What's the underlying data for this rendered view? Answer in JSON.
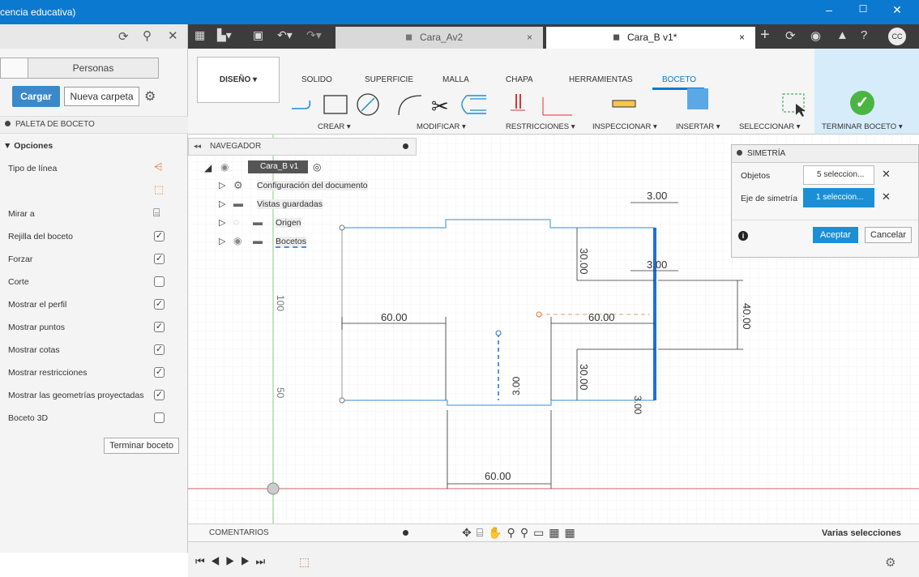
{
  "window": {
    "title": "cencia educativa)",
    "controls": [
      "–",
      "☐",
      "✕"
    ]
  },
  "left_panel": {
    "tab_right": "Personas",
    "load_button": "Cargar",
    "new_folder_button": "Nueva carpeta",
    "palette_header": "PALETA DE BOCETO",
    "options_header": "▼ Opciones",
    "options": [
      {
        "label": "Tipo de línea",
        "value": "icon"
      },
      {
        "label": "Mirar a",
        "value": "icon"
      },
      {
        "label": "Rejilla del boceto",
        "checked": true
      },
      {
        "label": "Forzar",
        "checked": true
      },
      {
        "label": "Corte",
        "checked": false
      },
      {
        "label": "Mostrar el perfil",
        "checked": true
      },
      {
        "label": "Mostrar puntos",
        "checked": true
      },
      {
        "label": "Mostrar cotas",
        "checked": true
      },
      {
        "label": "Mostrar restricciones",
        "checked": true
      },
      {
        "label": "Mostrar las geometrías proyectadas",
        "checked": true
      },
      {
        "label": "Boceto 3D",
        "checked": false
      }
    ],
    "finish_button": "Terminar boceto"
  },
  "tabs": [
    {
      "label": "Cara_Av2",
      "close": "×",
      "active": false
    },
    {
      "label": "Cara_B v1*",
      "close": "×",
      "active": true
    }
  ],
  "avatar": "CC",
  "ribbon": {
    "design_button": "DISEÑO ▾",
    "tabs": [
      "SOLIDO",
      "SUPERFICIE",
      "MALLA",
      "CHAPA",
      "HERRAMIENTAS",
      "BOCETO"
    ],
    "active_tab": "BOCETO",
    "groups": [
      "CREAR ▾",
      "MODIFICAR ▾",
      "RESTRICCIONES ▾",
      "INSPECCIONAR ▾",
      "INSERTAR ▾",
      "SELECCIONAR ▾",
      "TERMINAR BOCETO ▾"
    ]
  },
  "navigator": {
    "header": "NAVEGADOR",
    "root": "Cara_B v1",
    "items": [
      "Configuración del documento",
      "Vistas guardadas",
      "Origen",
      "Bocetos"
    ]
  },
  "symmetry": {
    "header": "SIMETRÍA",
    "objects_label": "Objetos",
    "objects_value": "5 seleccion...",
    "axis_label": "Eje de simetría",
    "axis_value": "1 seleccion...",
    "accept": "Aceptar",
    "cancel": "Cancelar"
  },
  "dims": {
    "d300a": "3.00",
    "d300b": "3.00",
    "d30a": "30.00",
    "d30b": "30.00",
    "d40": "40.00",
    "d60a": "60.00",
    "d60b": "60.00",
    "d60c": "60.00",
    "d3c": "3.00",
    "d3d": "3.00",
    "ruler100": "100",
    "ruler50": "50"
  },
  "comments": "COMENTARIOS",
  "status": "Varias selecciones",
  "colors": {
    "titlebar": "#0b79d0",
    "accent": "#1b8fd6",
    "sketch": "#7ab3e0",
    "selected": "#1e6fd6"
  }
}
